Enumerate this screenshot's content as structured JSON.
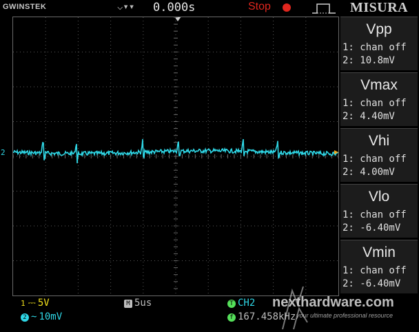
{
  "header": {
    "brand": "GWINSTEK",
    "trigger_icons": "⌵▾▾",
    "time_offset": "0.000s",
    "run_state": "Stop",
    "watermark_label": "MISURA"
  },
  "waveform": {
    "channel_marker": "2",
    "color": "#2fd7e6"
  },
  "measurements": [
    {
      "title": "Vpp",
      "ch1": "1: chan off",
      "ch2": "2: 10.8mV"
    },
    {
      "title": "Vmax",
      "ch1": "1: chan off",
      "ch2": "2: 4.40mV"
    },
    {
      "title": "Vhi",
      "ch1": "1: chan off",
      "ch2": "2: 4.00mV"
    },
    {
      "title": "Vlo",
      "ch1": "1: chan off",
      "ch2": "2: -6.40mV"
    },
    {
      "title": "Vmin",
      "ch1": "1: chan off",
      "ch2": "2: -6.40mV"
    }
  ],
  "bottom": {
    "ch1_badge": "1",
    "ch1_coupling": "⎓",
    "ch1_scale": "5V",
    "ch2_badge": "2",
    "ch2_coupling": "~",
    "ch2_scale": "10mV",
    "timebase_badge": "M",
    "timebase": "5us",
    "trigger_badge": "T",
    "trigger_source": "CH2",
    "freq_badge": "f",
    "frequency": "167.458kHz"
  },
  "watermark": {
    "text": "nexthardware.com",
    "subtitle": "your ultimate professional resource"
  },
  "colors": {
    "ch1": "#f2e11c",
    "ch2": "#2fd7e6",
    "stop": "#e0261e",
    "grid": "#5a5a5a"
  }
}
